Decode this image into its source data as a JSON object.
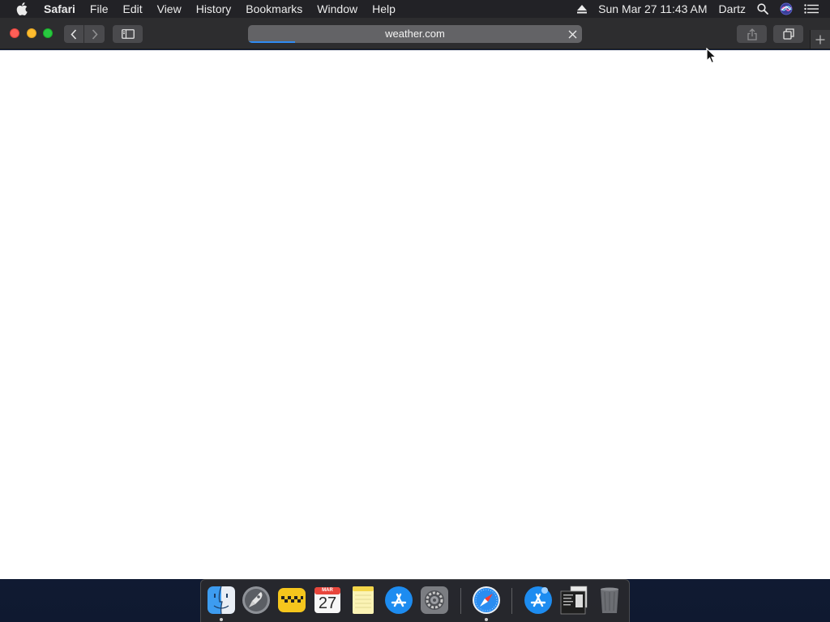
{
  "menubar": {
    "app_name": "Safari",
    "items": [
      {
        "label": "File"
      },
      {
        "label": "Edit"
      },
      {
        "label": "View"
      },
      {
        "label": "History"
      },
      {
        "label": "Bookmarks"
      },
      {
        "label": "Window"
      },
      {
        "label": "Help"
      }
    ],
    "clock": "Sun Mar 27  11:43 AM",
    "user": "Dartz"
  },
  "toolbar": {
    "url": "weather.com",
    "load_progress": 0.14
  },
  "dock": {
    "calendar_month": "MAR",
    "calendar_day": "27",
    "apps": [
      "Finder",
      "Launchpad",
      "Taxi",
      "Calendar",
      "Notes",
      "App Store",
      "System Preferences",
      "Safari",
      "App Store Download",
      "Preview Document",
      "Trash"
    ]
  },
  "colors": {
    "progress": "#2f8cf5",
    "close": "#fe5f57",
    "minimize": "#febc2e",
    "maximize": "#28c840"
  }
}
